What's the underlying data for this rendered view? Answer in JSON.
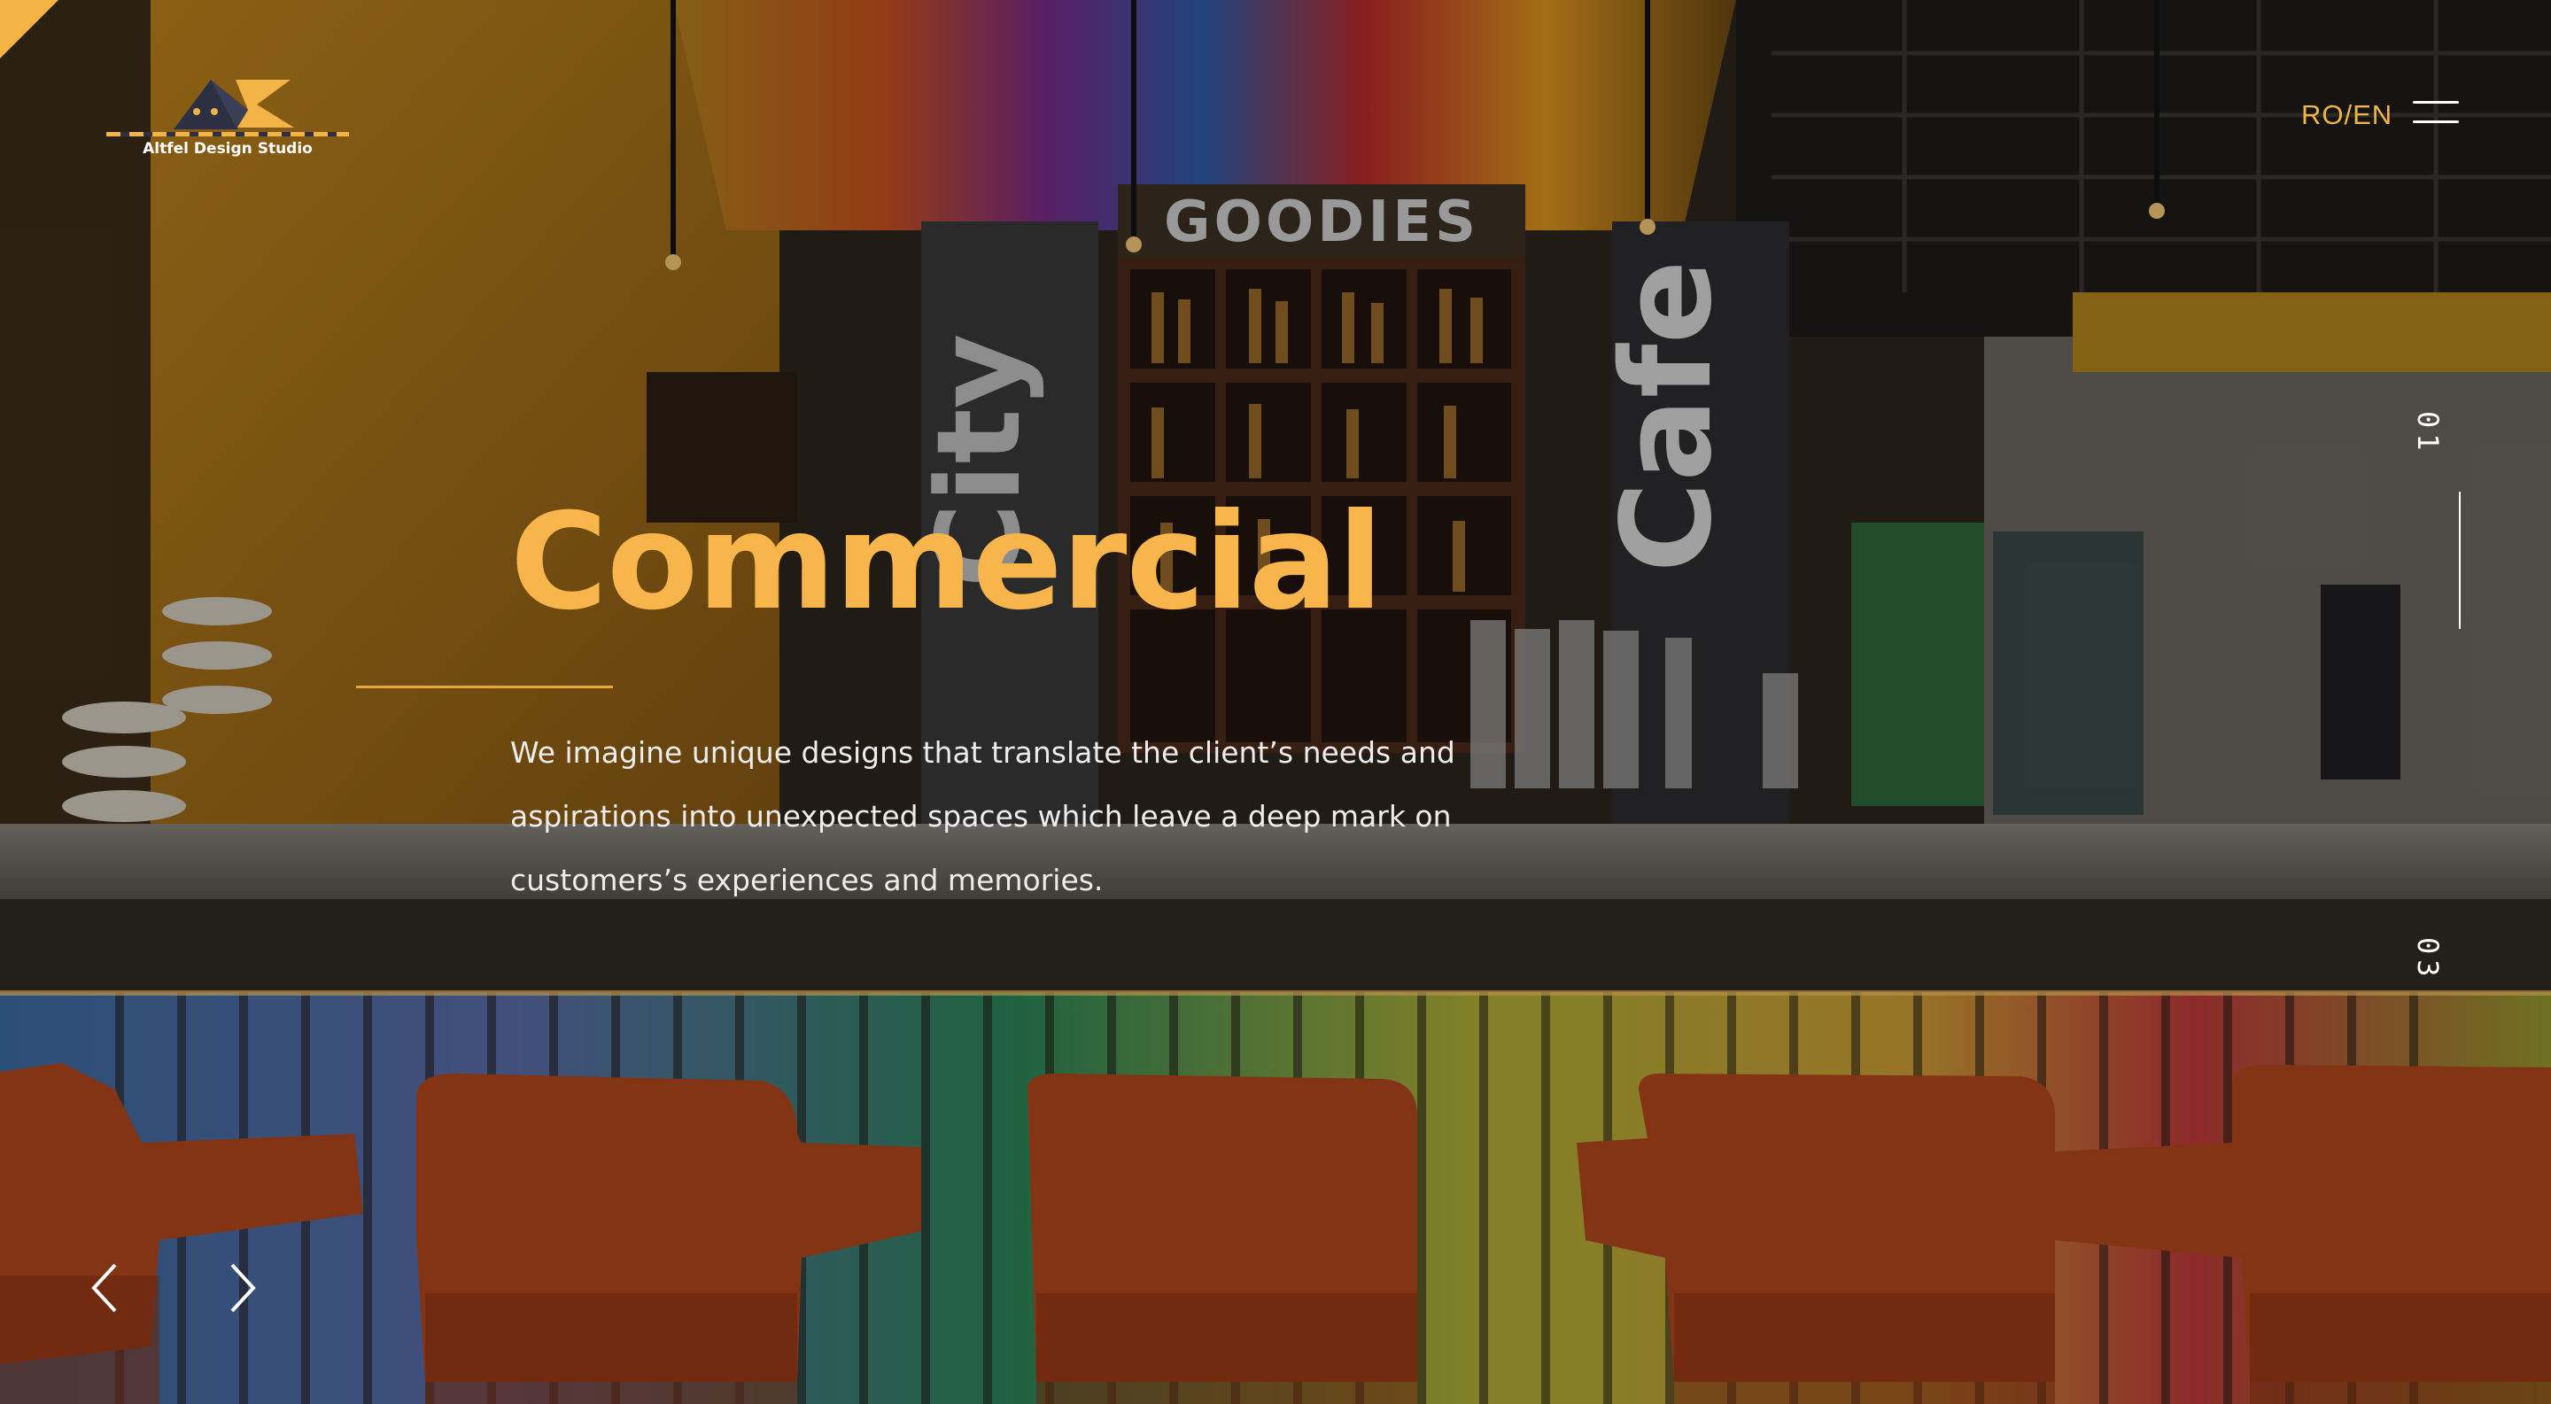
{
  "brand": {
    "name": "Altfel Design Studio"
  },
  "header": {
    "language_label": "RO/EN",
    "menu_icon": "hamburger-menu-icon"
  },
  "hero": {
    "title": "Commercial",
    "description": "We imagine unique designs that translate the client’s needs and aspirations into unexpected spaces which leave a deep mark on customers’s experiences and memories.",
    "scene_signage": {
      "shelf_sign": "GOODIES",
      "left_sign": "City",
      "right_sign": "Cafe"
    }
  },
  "slider": {
    "current_slide": "01",
    "total_slides": "03",
    "progress": 0.33
  },
  "nav": {
    "prev_icon": "chevron-left-icon",
    "next_icon": "chevron-right-icon"
  },
  "colors": {
    "accent": "#f2b447",
    "title": "#f7b54b",
    "text": "#ececec",
    "overlay": "rgba(10,8,5,0.30)"
  }
}
